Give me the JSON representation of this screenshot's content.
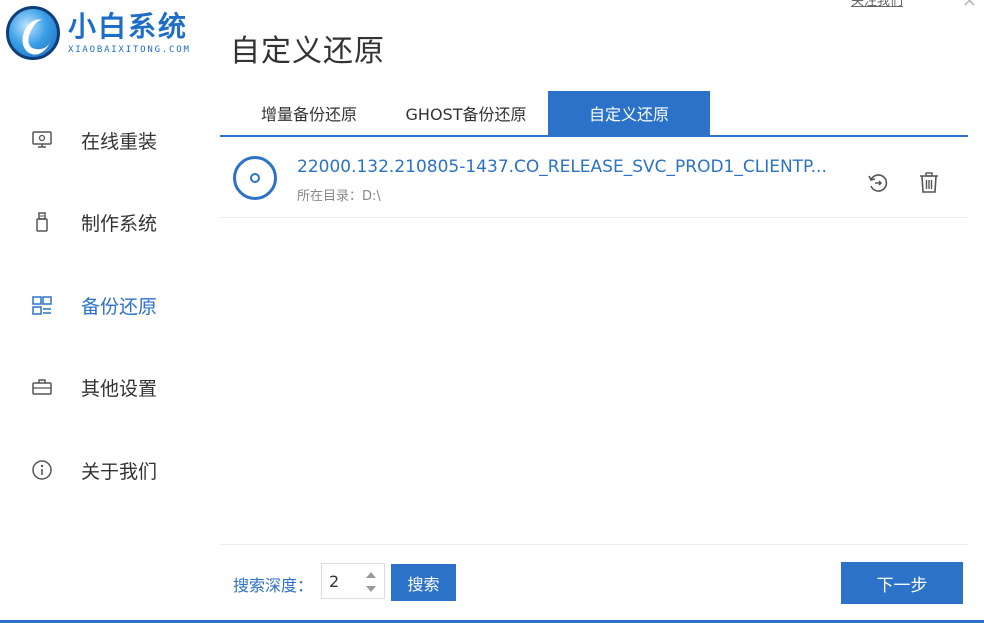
{
  "app": {
    "logo_title": "小白系统",
    "logo_subtitle": "XIAOBAIXITONG.COM",
    "page_title": "自定义还原",
    "top_link": "关注我们"
  },
  "sidebar": {
    "items": [
      {
        "label": "在线重装",
        "icon": "monitor-icon",
        "active": false
      },
      {
        "label": "制作系统",
        "icon": "usb-drive-icon",
        "active": false
      },
      {
        "label": "备份还原",
        "icon": "backup-icon",
        "active": true
      },
      {
        "label": "其他设置",
        "icon": "briefcase-icon",
        "active": false
      },
      {
        "label": "关于我们",
        "icon": "info-icon",
        "active": false
      }
    ]
  },
  "tabs": [
    {
      "label": "增量备份还原",
      "active": false
    },
    {
      "label": "GHOST备份还原",
      "active": false
    },
    {
      "label": "自定义还原",
      "active": true
    }
  ],
  "files": [
    {
      "name": "22000.132.210805-1437.CO_RELEASE_SVC_PROD1_CLIENTP...",
      "directory": "所在目录：D:\\",
      "icon": "disc-icon"
    }
  ],
  "bottom": {
    "depth_label": "搜索深度：",
    "depth_value": "2",
    "search_label": "搜索",
    "next_label": "下一步"
  },
  "colors": {
    "accent": "#2b72c8",
    "text": "#333333",
    "muted": "#888888"
  }
}
